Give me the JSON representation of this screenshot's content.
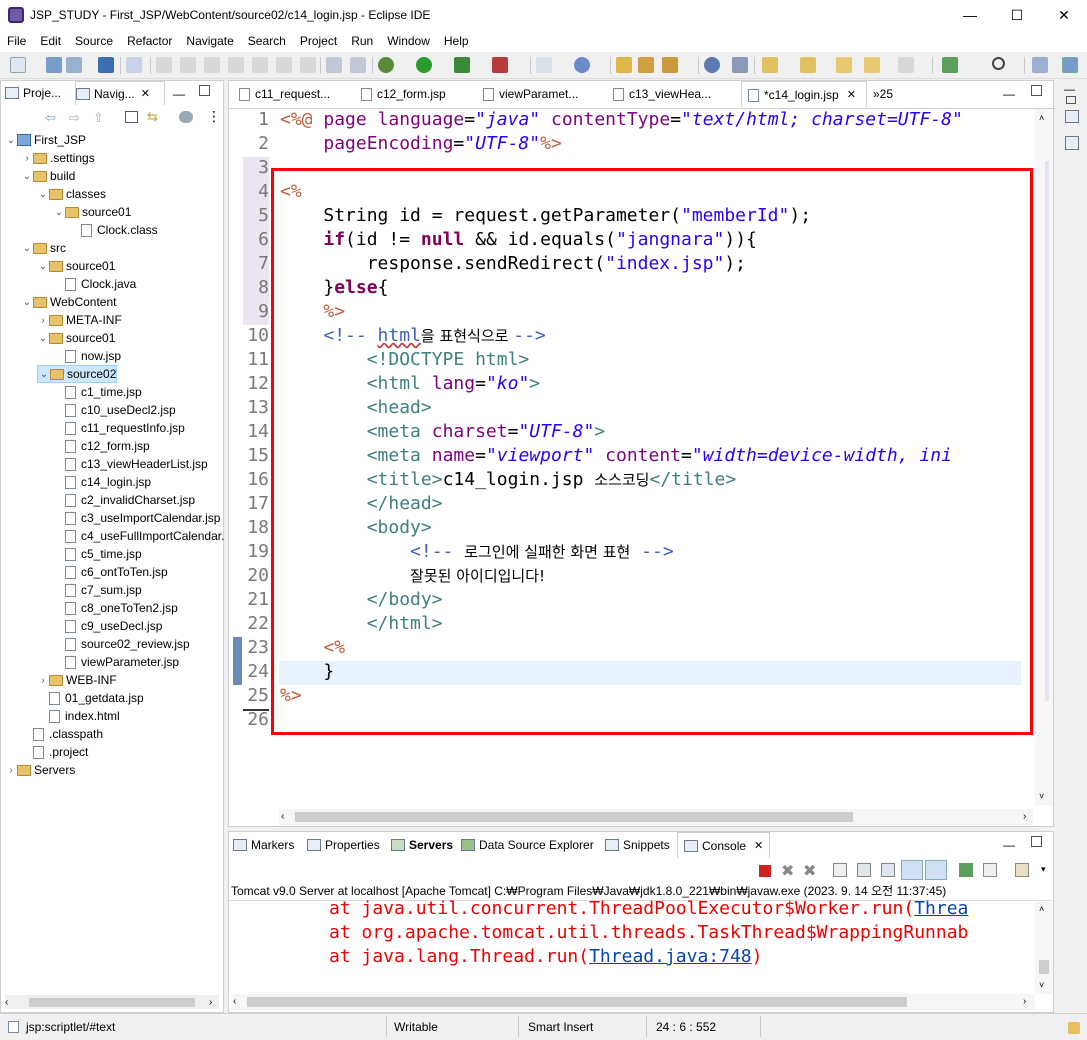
{
  "window": {
    "title": "JSP_STUDY - First_JSP/WebContent/source02/c14_login.jsp - Eclipse IDE",
    "controls": [
      "—",
      "☐",
      "✕"
    ]
  },
  "menu": [
    "File",
    "Edit",
    "Source",
    "Refactor",
    "Navigate",
    "Search",
    "Project",
    "Run",
    "Window",
    "Help"
  ],
  "left_panel": {
    "tabs": [
      {
        "label": "Proje..."
      },
      {
        "label": "Navig...",
        "close": "✕"
      }
    ],
    "tree": [
      {
        "label": "First_JSP",
        "depth": 0,
        "arrow": "v",
        "icon": "proj"
      },
      {
        "label": ".settings",
        "depth": 1,
        "arrow": ">",
        "icon": "folder"
      },
      {
        "label": "build",
        "depth": 1,
        "arrow": "v",
        "icon": "folder"
      },
      {
        "label": "classes",
        "depth": 2,
        "arrow": "v",
        "icon": "folder"
      },
      {
        "label": "source01",
        "depth": 3,
        "arrow": "v",
        "icon": "folder"
      },
      {
        "label": "Clock.class",
        "depth": 4,
        "arrow": "",
        "icon": "file"
      },
      {
        "label": "src",
        "depth": 1,
        "arrow": "v",
        "icon": "folder"
      },
      {
        "label": "source01",
        "depth": 2,
        "arrow": "v",
        "icon": "folder"
      },
      {
        "label": "Clock.java",
        "depth": 3,
        "arrow": "",
        "icon": "file"
      },
      {
        "label": "WebContent",
        "depth": 1,
        "arrow": "v",
        "icon": "folder"
      },
      {
        "label": "META-INF",
        "depth": 2,
        "arrow": ">",
        "icon": "folder"
      },
      {
        "label": "source01",
        "depth": 2,
        "arrow": "v",
        "icon": "folder"
      },
      {
        "label": "now.jsp",
        "depth": 3,
        "arrow": "",
        "icon": "file"
      },
      {
        "label": "source02",
        "depth": 2,
        "arrow": "v",
        "icon": "folder",
        "selected": true
      },
      {
        "label": "c1_time.jsp",
        "depth": 3,
        "arrow": "",
        "icon": "file"
      },
      {
        "label": "c10_useDecl2.jsp",
        "depth": 3,
        "arrow": "",
        "icon": "file"
      },
      {
        "label": "c11_requestInfo.jsp",
        "depth": 3,
        "arrow": "",
        "icon": "file"
      },
      {
        "label": "c12_form.jsp",
        "depth": 3,
        "arrow": "",
        "icon": "file"
      },
      {
        "label": "c13_viewHeaderList.jsp",
        "depth": 3,
        "arrow": "",
        "icon": "file"
      },
      {
        "label": "c14_login.jsp",
        "depth": 3,
        "arrow": "",
        "icon": "file"
      },
      {
        "label": "c2_invalidCharset.jsp",
        "depth": 3,
        "arrow": "",
        "icon": "file"
      },
      {
        "label": "c3_useImportCalendar.jsp",
        "depth": 3,
        "arrow": "",
        "icon": "file"
      },
      {
        "label": "c4_useFullImportCalendar.",
        "depth": 3,
        "arrow": "",
        "icon": "file"
      },
      {
        "label": "c5_time.jsp",
        "depth": 3,
        "arrow": "",
        "icon": "file"
      },
      {
        "label": "c6_ontToTen.jsp",
        "depth": 3,
        "arrow": "",
        "icon": "file"
      },
      {
        "label": "c7_sum.jsp",
        "depth": 3,
        "arrow": "",
        "icon": "file"
      },
      {
        "label": "c8_oneToTen2.jsp",
        "depth": 3,
        "arrow": "",
        "icon": "file"
      },
      {
        "label": "c9_useDecl.jsp",
        "depth": 3,
        "arrow": "",
        "icon": "file"
      },
      {
        "label": "source02_review.jsp",
        "depth": 3,
        "arrow": "",
        "icon": "file"
      },
      {
        "label": "viewParameter.jsp",
        "depth": 3,
        "arrow": "",
        "icon": "file"
      },
      {
        "label": "WEB-INF",
        "depth": 2,
        "arrow": ">",
        "icon": "folder"
      },
      {
        "label": "01_getdata.jsp",
        "depth": 2,
        "arrow": "",
        "icon": "file"
      },
      {
        "label": "index.html",
        "depth": 2,
        "arrow": "",
        "icon": "file"
      },
      {
        "label": ".classpath",
        "depth": 1,
        "arrow": "",
        "icon": "file"
      },
      {
        "label": ".project",
        "depth": 1,
        "arrow": "",
        "icon": "file"
      },
      {
        "label": "Servers",
        "depth": 0,
        "arrow": ">",
        "icon": "folder"
      }
    ]
  },
  "editor": {
    "tabs": [
      {
        "label": "c11_request..."
      },
      {
        "label": "c12_form.jsp"
      },
      {
        "label": "viewParamet..."
      },
      {
        "label": "c13_viewHea..."
      },
      {
        "label": "*c14_login.jsp",
        "close": "✕",
        "active": true
      },
      {
        "label": "»25"
      }
    ],
    "line_numbers": [
      "1",
      "2",
      "3",
      "4",
      "5",
      "6",
      "7",
      "8",
      "9",
      "10",
      "11",
      "12",
      "13",
      "14",
      "15",
      "16",
      "17",
      "18",
      "19",
      "20",
      "21",
      "22",
      "23",
      "24",
      "25",
      "26"
    ],
    "code": {
      "l1_jsp": "<%@",
      "l1_page": "page",
      "l1_language": "language",
      "l1_eq": "=",
      "l1_java": "\"java\"",
      "l1_contentType": "contentType",
      "l1_eq2": "=",
      "l1_ct": "\"text/html; charset=UTF-8\"",
      "l2_pageEncoding": "pageEncoding",
      "l2_eq": "=",
      "l2_utf": "\"UTF-8\"",
      "l2_close": "%>",
      "l4_open": "<%",
      "l5_a": "String id = request.getParameter(",
      "l5_str": "\"memberId\"",
      "l5_b": ");",
      "l6_if": "if",
      "l6_a": "(id != ",
      "l6_null": "null",
      "l6_b": " && id.equals(",
      "l6_str": "\"jangnara\"",
      "l6_c": ")){",
      "l7_a": "response.sendRedirect(",
      "l7_str": "\"index.jsp\"",
      "l7_b": ");",
      "l8_a": "}",
      "l8_else": "else",
      "l8_b": "{",
      "l9_close": "%>",
      "l10_a": "<!-- ",
      "l10_html": "html",
      "l10_ko": "을 표현식으로 ",
      "l10_b": "-->",
      "l11": "<!DOCTYPE html>",
      "l12_a": "<html ",
      "l12_lang": "lang",
      "l12_eq": "=",
      "l12_ko": "\"ko\"",
      "l12_b": ">",
      "l13": "<head>",
      "l14_a": "<meta ",
      "l14_charset": "charset",
      "l14_eq": "=",
      "l14_utf": "\"UTF-8\"",
      "l14_b": ">",
      "l15_a": "<meta ",
      "l15_name": "name",
      "l15_eq": "=",
      "l15_vp": "\"viewport\"",
      "l15_content": "content",
      "l15_eq2": "=",
      "l15_val": "\"width=device-width, ini",
      "l16_a": "<title>",
      "l16_text": "c14_login.jsp ",
      "l16_ko": "소스코딩",
      "l16_b": "</title>",
      "l17": "</head>",
      "l18": "<body>",
      "l19_a": "<!-- ",
      "l19_ko": "로그인에 실패한 화면 표현",
      "l19_b": " -->",
      "l20_ko": "잘못된 아이디입니다!",
      "l21": "</body>",
      "l22": "</html>",
      "l23": "<%",
      "l24": "}",
      "l25": "%>"
    },
    "highlight_color": "#ff0000"
  },
  "bottom_panel": {
    "tabs": [
      "Markers",
      "Properties",
      "Servers",
      "Data Source Explorer",
      "Snippets",
      "Console"
    ],
    "console_close": "✕",
    "server_line": "Tomcat v9.0 Server at localhost [Apache Tomcat] C:₩Program Files₩Java₩jdk1.8.0_221₩bin₩javaw.exe  (2023. 9. 14 오전 11:37:45)",
    "lines": [
      {
        "text": "at java.util.concurrent.ThreadPoolExecutor$Worker.run(",
        "link": "Threa"
      },
      {
        "text": "at org.apache.tomcat.util.threads.TaskThread$WrappingRunnab",
        "link": ""
      },
      {
        "text": "at java.lang.Thread.run(",
        "link": "Thread.java:748",
        "tail": ")"
      }
    ]
  },
  "status": {
    "path": "jsp:scriptlet/#text",
    "mode": "Writable",
    "insert": "Smart Insert",
    "position": "24 : 6 : 552"
  }
}
